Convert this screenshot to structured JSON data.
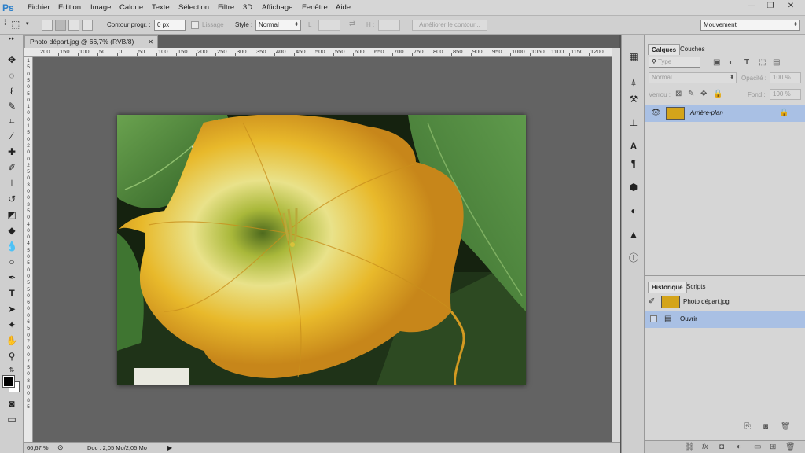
{
  "app": {
    "logo": "Ps"
  },
  "menu": [
    "Fichier",
    "Edition",
    "Image",
    "Calque",
    "Texte",
    "Sélection",
    "Filtre",
    "3D",
    "Affichage",
    "Fenêtre",
    "Aide"
  ],
  "window_controls": {
    "minimize": "—",
    "restore": "❐",
    "close": "✕"
  },
  "options": {
    "feather_label": "Contour progr. :",
    "feather_value": "0 px",
    "antialias_label": "Lissage",
    "style_label": "Style :",
    "style_value": "Normal",
    "width_label": "L :",
    "height_label": "H :",
    "refine_label": "Améliorer le contour...",
    "workspace_value": "Mouvement"
  },
  "document": {
    "tab_label": "Photo départ.jpg @ 66,7% (RVB/8)",
    "ruler_top": [
      "200",
      "150",
      "100",
      "50",
      "0",
      "50",
      "100",
      "150",
      "200",
      "250",
      "300",
      "350",
      "400",
      "450",
      "500",
      "550",
      "600",
      "650",
      "700",
      "750",
      "800",
      "850",
      "900",
      "950",
      "1000",
      "1050",
      "1100",
      "1150",
      "1200"
    ],
    "ruler_left": [
      "1",
      "5",
      "0",
      "5",
      "0",
      "5",
      "0",
      "1",
      "0",
      "0",
      "1",
      "5",
      "0",
      "2",
      "0",
      "0",
      "2",
      "5",
      "0",
      "3",
      "0",
      "0",
      "3",
      "5",
      "0",
      "4",
      "0",
      "0",
      "4",
      "5",
      "0",
      "5",
      "0",
      "0",
      "5",
      "5",
      "0",
      "6",
      "0",
      "0",
      "6",
      "5",
      "0",
      "7",
      "0",
      "0",
      "7",
      "5",
      "0",
      "8",
      "0",
      "0",
      "8",
      "5"
    ],
    "zoom": "66,67 %",
    "doc_size": "Doc : 2,05 Mo/2,05 Mo"
  },
  "layers_panel": {
    "tab_layers": "Calques",
    "tab_channels": "Couches",
    "filter_placeholder": "Type",
    "blend_mode": "Normal",
    "opacity_label": "Opacité :",
    "opacity_value": "100 %",
    "lock_label": "Verrou :",
    "fill_label": "Fond :",
    "fill_value": "100 %",
    "layer_name": "Arrière-plan"
  },
  "history_panel": {
    "tab_history": "Historique",
    "tab_scripts": "Scripts",
    "snapshot_name": "Photo départ.jpg",
    "step_name": "Ouvrir"
  },
  "colors": {
    "selection_blue": "#a9c0e4",
    "flower_yellow": "#e0a91c",
    "leaf_green": "#4f8a3a"
  }
}
